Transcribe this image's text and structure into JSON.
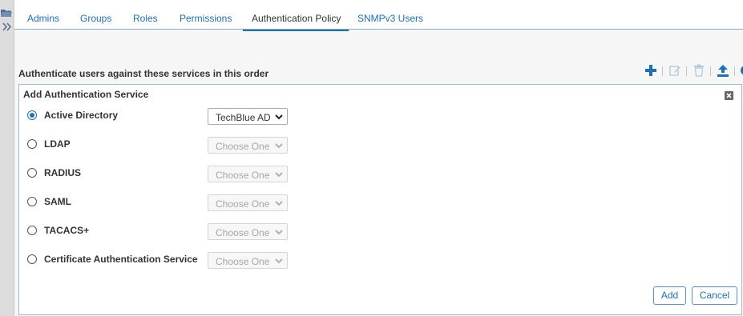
{
  "tabs": [
    {
      "label": "Admins",
      "active": false
    },
    {
      "label": "Groups",
      "active": false
    },
    {
      "label": "Roles",
      "active": false
    },
    {
      "label": "Permissions",
      "active": false
    },
    {
      "label": "Authentication Policy",
      "active": true
    },
    {
      "label": "SNMPv3 Users",
      "active": false
    }
  ],
  "section_heading": "Authenticate users against these services in this order",
  "toolbar": {
    "add_icon": "plus-icon",
    "edit_icon": "edit-icon",
    "delete_icon": "trash-icon",
    "move_icon": "upload-arrow-icon"
  },
  "panel": {
    "title": "Add Authentication Service",
    "services": [
      {
        "label": "Active Directory",
        "selected": true,
        "select_value": "TechBlue AD",
        "select_enabled": true
      },
      {
        "label": "LDAP",
        "selected": false,
        "select_value": "Choose One",
        "select_enabled": false
      },
      {
        "label": "RADIUS",
        "selected": false,
        "select_value": "Choose One",
        "select_enabled": false
      },
      {
        "label": "SAML",
        "selected": false,
        "select_value": "Choose One",
        "select_enabled": false
      },
      {
        "label": "TACACS+",
        "selected": false,
        "select_value": "Choose One",
        "select_enabled": false
      },
      {
        "label": "Certificate Authentication Service",
        "selected": false,
        "select_value": "Choose One",
        "select_enabled": false
      }
    ],
    "add_label": "Add",
    "cancel_label": "Cancel"
  },
  "colors": {
    "accent": "#1f6fb5",
    "panel_border": "#9bbbd8"
  }
}
